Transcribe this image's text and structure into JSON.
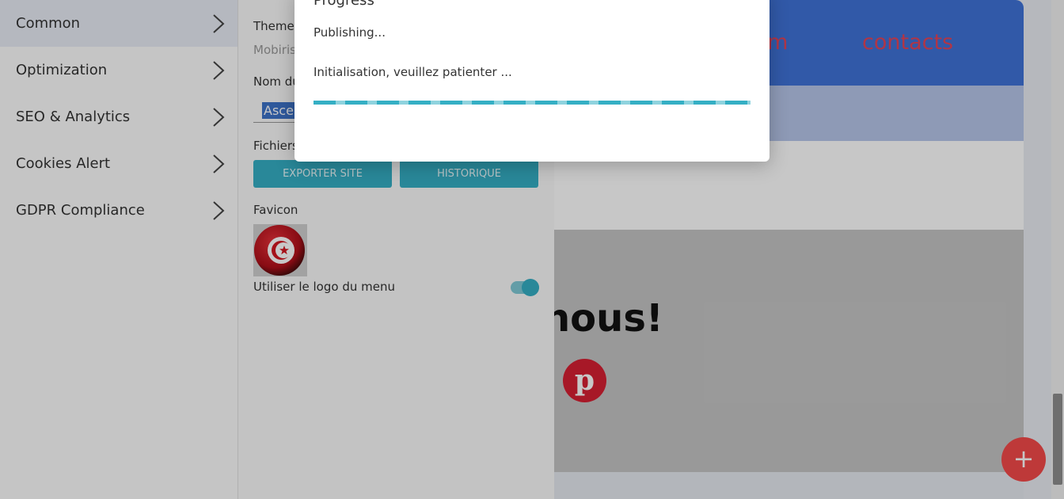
{
  "left_menu": {
    "items": [
      {
        "label": "Common",
        "active": true
      },
      {
        "label": "Optimization"
      },
      {
        "label": "SEO & Analytics"
      },
      {
        "label": "Cookies Alert"
      },
      {
        "label": "GDPR Compliance"
      }
    ]
  },
  "settings": {
    "theme_label": "Theme N",
    "theme_value": "Mobirise",
    "site_name_label": "Nom du",
    "site_name_value": "Ascen",
    "files_label": "Fichiers",
    "export_button": "EXPORTER SITE",
    "history_button": "HISTORIQUE",
    "favicon_label": "Favicon",
    "use_menu_logo_label": "Utiliser le logo du menu",
    "use_menu_logo_enabled": true
  },
  "preview": {
    "nav_item_partial": "um",
    "nav_item_contacts": "contacts",
    "heading_partial": "nous!"
  },
  "modal": {
    "title": "Progress",
    "status": "Publishing...",
    "message": "Initialisation, veuillez patienter ...",
    "progress": 1.0
  },
  "colors": {
    "accent": "#35afc4",
    "nav_blue": "#3f73d8",
    "link_red": "#e2455a",
    "fab_red": "#f44a4a"
  },
  "icons": {
    "menu_chevron": "chevron-right-icon",
    "fab": "plus-icon",
    "social": "pinterest-icon"
  }
}
